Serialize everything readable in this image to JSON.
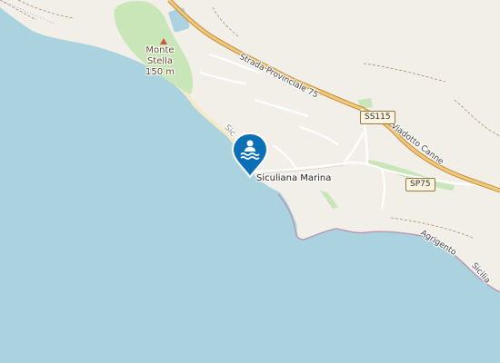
{
  "map": {
    "places": {
      "siculiana_marina": "Siculiana Marina",
      "monte_stella_name": "Monte\nStella",
      "monte_stella_elev": "150 m"
    },
    "roads": {
      "strada_provinciale_75": "Strada Provinciale 75",
      "viadotto_canne": "Viadotto Canne",
      "agrigento_sicilia": "Agrigento",
      "sicilia": "Sicilia",
      "sic_coast": "Sic"
    },
    "shields": {
      "ss115": "SS115",
      "sp75": "SP75"
    },
    "marker": {
      "icon": "swimming-icon",
      "color": "#0b6fb5"
    },
    "colors": {
      "sea": "#aad3df",
      "land": "#f2efe9",
      "park": "#c8e6b8",
      "beach": "#f5e9c6",
      "trunk_road": "#e6b96b"
    }
  }
}
